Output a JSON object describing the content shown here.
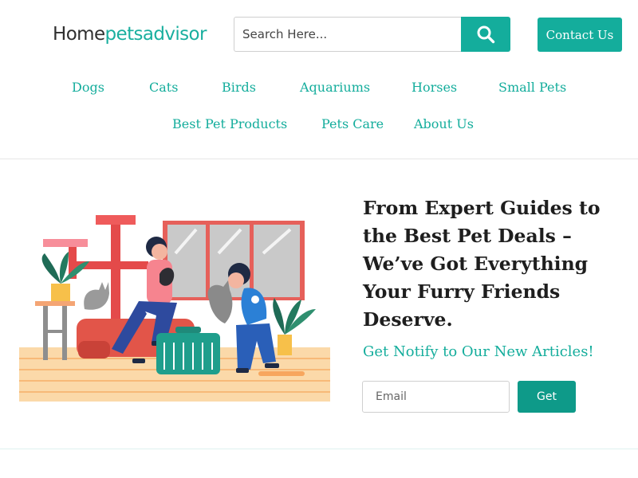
{
  "header": {
    "logo_part1": "Home",
    "logo_part2": "petsadvisor",
    "search_placeholder": "Search Here...",
    "contact_label": "Contact Us"
  },
  "nav": {
    "row1": [
      "Dogs",
      "Cats",
      "Birds",
      "Aquariums",
      "Horses",
      "Small Pets"
    ],
    "row2": [
      "Best Pet Products",
      "Pets Care",
      "About Us"
    ]
  },
  "hero": {
    "title": "From Expert Guides to the Best Pet Deals – We’ve Got Everything Your Furry Friends Deserve.",
    "subtitle": "Get Notify to Our New Articles!",
    "email_placeholder": "Email",
    "get_label": "Get"
  },
  "colors": {
    "brand": "#14ad9c",
    "heading": "#1e1e1e"
  },
  "icons": [
    "search-icon"
  ]
}
